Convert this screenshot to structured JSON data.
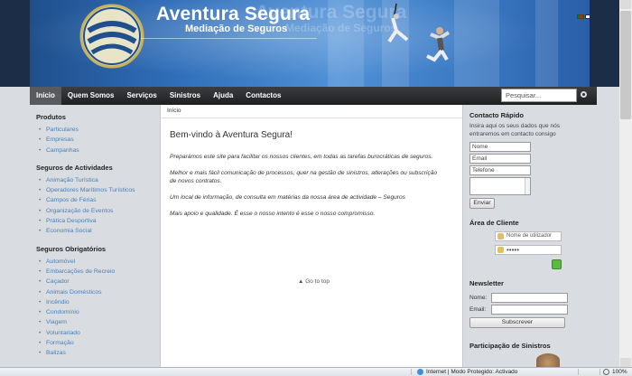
{
  "brand": {
    "name": "Aventura Segura",
    "tagline": "Mediação de Seguros"
  },
  "languages": [
    "pt-flag",
    "gb-flag",
    "fr-flag",
    "de-flag"
  ],
  "nav": {
    "items": [
      "Início",
      "Quem Somos",
      "Serviços",
      "Sinistros",
      "Ajuda",
      "Contactos"
    ],
    "search_placeholder": "Pesquisar..."
  },
  "sidebar": {
    "sections": [
      {
        "title": "Produtos",
        "items": [
          "Particulares",
          "Empresas",
          "Campanhas"
        ]
      },
      {
        "title": "Seguros de Actividades",
        "items": [
          "Animação Turística",
          "Operadores Marítimos Turísticos",
          "Campos de Férias",
          "Organização de Eventos",
          "Prática Desportiva",
          "Economia Social"
        ]
      },
      {
        "title": "Seguros Obrigatórios",
        "items": [
          "Automóvel",
          "Embarcações de Recreio",
          "Caçador",
          "Animais Domésticos",
          "Incêndio",
          "Condomínio",
          "Viagem",
          "Voluntariado",
          "Formação",
          "Balizas"
        ]
      }
    ]
  },
  "main": {
    "breadcrumb": "Início",
    "title": "Bem-vindo à Aventura Segura!",
    "paragraphs": [
      "Preparámos este site para facilitar os nossos clientes, em todas as tarefas burocráticas de seguros.",
      "Melhor e mais fácil comunicação de processos, quer na gestão de sinistros, alterações ou subscrição de novos contratos.",
      "Um local de informação, de consulta em matérias da nossa área de actividade – Seguros",
      "Mais apoio e qualidade. É esse o nosso intento é esse o nosso compromisso."
    ],
    "go_to_top": "Go to top"
  },
  "contact": {
    "title": "Contacto Rápido",
    "text": "Insira aqui os seus dados que nós entraremos em contacto consigo",
    "name_value": "Nome",
    "email_value": "Email",
    "phone_value": "Telefone",
    "send_label": "Enviar"
  },
  "client_area": {
    "title": "Área de Cliente",
    "username_value": "Nome de utilizador",
    "password_value": "•••••"
  },
  "newsletter": {
    "title": "Newsletter",
    "name_label": "Nome:",
    "email_label": "Email:",
    "subscribe_label": "Subscrever"
  },
  "claims": {
    "title": "Participação de Sinistros"
  },
  "statusbar": {
    "zone_text": "Internet | Modo Protegido: Activado",
    "zoom": "100%"
  },
  "colors": {
    "nav_bg": "#2b2c2e",
    "link": "#4a7fb5",
    "accent_blue": "#2f6db8",
    "ok_green": "#5cbb3e"
  }
}
